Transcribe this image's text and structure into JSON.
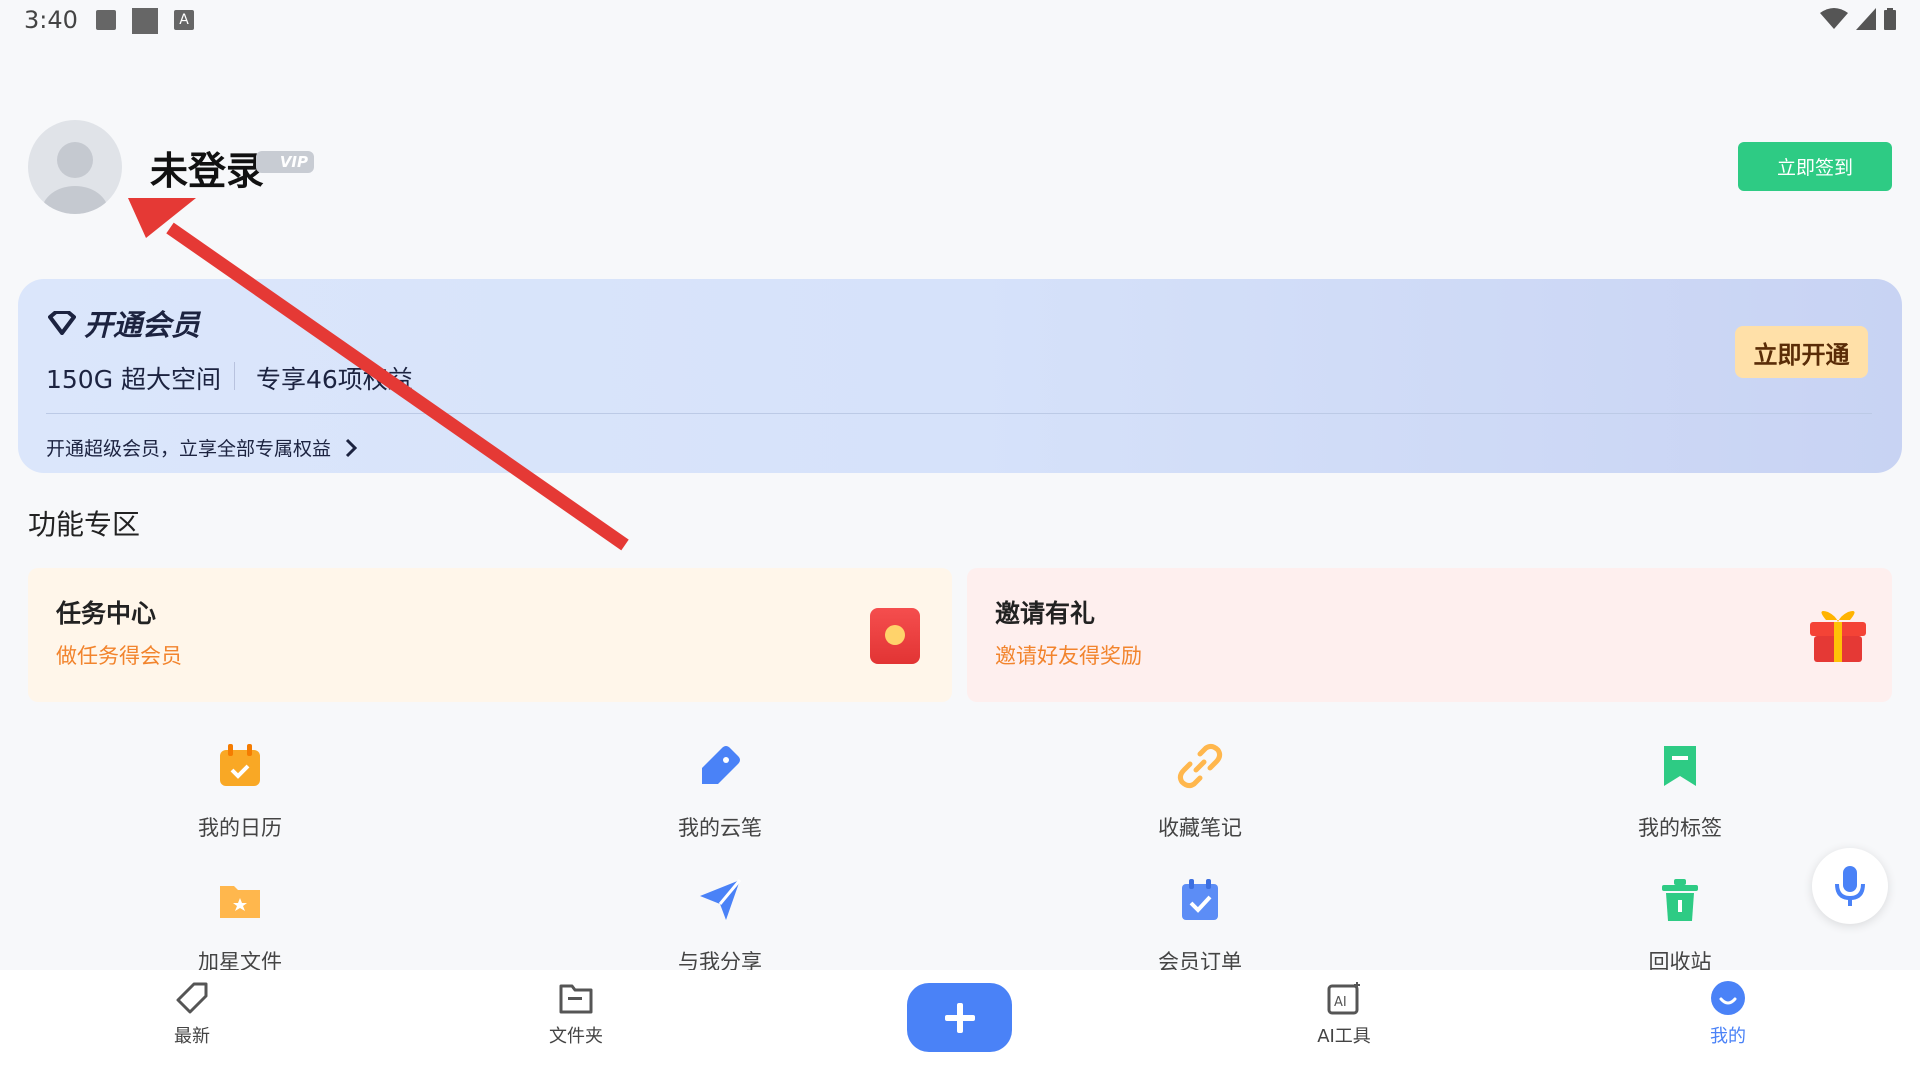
{
  "status_bar": {
    "time": "3:40",
    "icons": [
      "image-icon",
      "square-icon",
      "a-icon",
      "wifi-icon",
      "signal-icon",
      "battery-icon"
    ]
  },
  "header": {
    "username": "未登录",
    "vip_badge": "VIP",
    "checkin_label": "立即签到"
  },
  "member_banner": {
    "title": "开通会员",
    "benefit_1": "150G 超大空间",
    "benefit_2": "专享46项权益",
    "subtitle": "开通超级会员，立享全部专属权益",
    "button_label": "立即开通"
  },
  "section_title": "功能专区",
  "cards": [
    {
      "title": "任务中心",
      "subtitle": "做任务得会员",
      "icon": "red-packet-icon"
    },
    {
      "title": "邀请有礼",
      "subtitle": "邀请好友得奖励",
      "icon": "gift-icon"
    }
  ],
  "grid": [
    {
      "label": "我的日历",
      "icon": "calendar-icon"
    },
    {
      "label": "我的云笔",
      "icon": "cloud-pen-icon"
    },
    {
      "label": "收藏笔记",
      "icon": "link-icon"
    },
    {
      "label": "我的标签",
      "icon": "bookmark-icon"
    },
    {
      "label": "加星文件",
      "icon": "star-folder-icon"
    },
    {
      "label": "与我分享",
      "icon": "send-icon"
    },
    {
      "label": "会员订单",
      "icon": "order-icon"
    },
    {
      "label": "回收站",
      "icon": "trash-icon"
    }
  ],
  "bottom_nav": [
    {
      "label": "最新",
      "icon": "tag-icon"
    },
    {
      "label": "文件夹",
      "icon": "folder-icon"
    },
    {
      "label": "",
      "icon": "plus-icon"
    },
    {
      "label": "AI工具",
      "icon": "ai-icon"
    },
    {
      "label": "我的",
      "icon": "profile-icon",
      "active": true
    }
  ],
  "colors": {
    "accent": "#4a82f7",
    "checkin_green": "#2ecb84",
    "orange_text": "#f2842d",
    "annotation_red": "#e53935"
  }
}
